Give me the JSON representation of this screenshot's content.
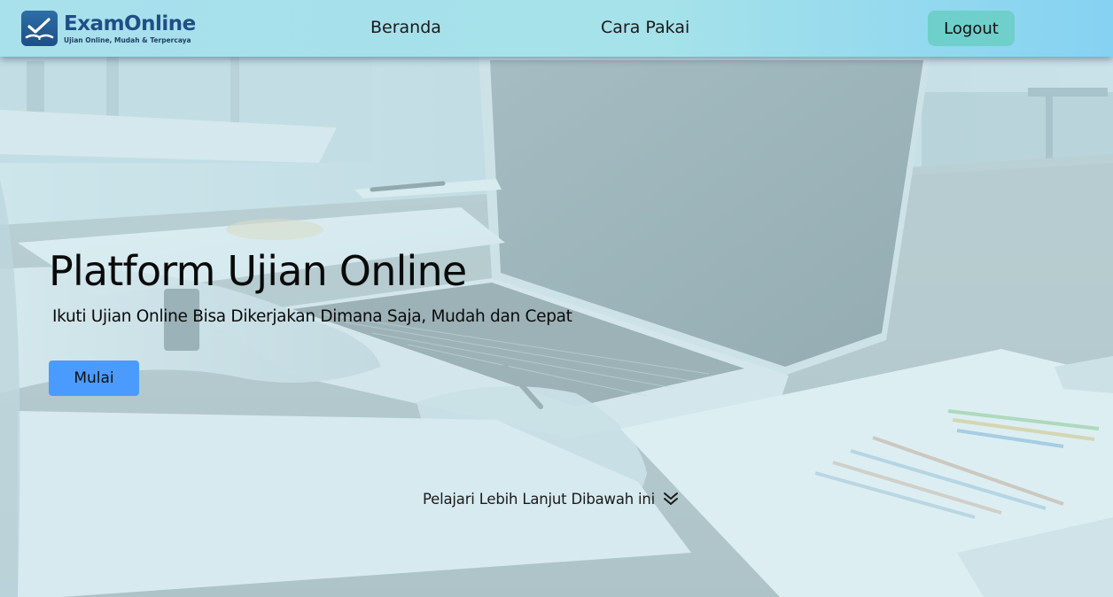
{
  "brand": {
    "name": "ExamOnline",
    "tagline": "Ujian Online, Mudah & Terpercaya",
    "logo_icon": "checkbook-icon"
  },
  "nav": {
    "items": [
      {
        "label": "Beranda"
      },
      {
        "label": "Cara Pakai"
      }
    ],
    "logout_label": "Logout"
  },
  "hero": {
    "title": "Platform Ujian Online",
    "subtitle": "Ikuti Ujian Online Bisa Dikerjakan Dimana Saja, Mudah dan Cepat",
    "start_label": "Mulai",
    "learn_more_label": "Pelajari Lebih Lanjut Dibawah ini",
    "learn_more_icon": "double-chevron-down-icon"
  },
  "colors": {
    "brand_blue": "#1f4e86",
    "navbar_bg": "#a8e0ec",
    "logout_bg": "#6fcfcb",
    "start_bg": "#4b9bff"
  }
}
